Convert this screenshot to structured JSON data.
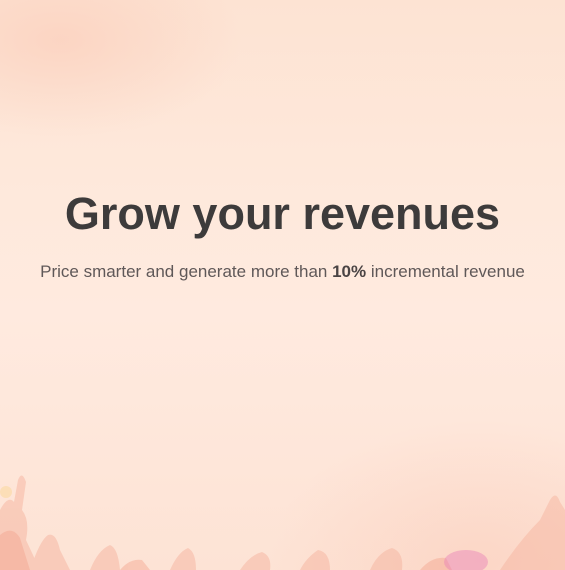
{
  "hero": {
    "title": "Grow your revenues",
    "subtitle_before": "Price smarter and generate more than ",
    "subtitle_highlight": "10%",
    "subtitle_after": " incremental revenue",
    "background_image": "concert-crowd-hands-raised",
    "colors": {
      "background": "#fde6d6",
      "title": "#3d3b3b",
      "subtitle": "#5f5858"
    }
  }
}
